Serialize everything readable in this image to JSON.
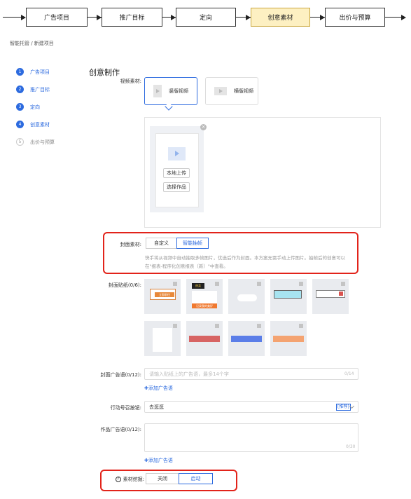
{
  "flow_steps": [
    {
      "label": "广告项目",
      "active": false
    },
    {
      "label": "推广目标",
      "active": false
    },
    {
      "label": "定向",
      "active": false
    },
    {
      "label": "创意素材",
      "active": true
    },
    {
      "label": "出价与预算",
      "active": false
    }
  ],
  "breadcrumb": "智能托管 / 新建项目",
  "side_steps": [
    {
      "num": "1",
      "label": "广告项目",
      "done": true
    },
    {
      "num": "2",
      "label": "推广目标",
      "done": true
    },
    {
      "num": "3",
      "label": "定向",
      "done": true
    },
    {
      "num": "4",
      "label": "创意素材",
      "done": true
    },
    {
      "num": "5",
      "label": "出价与预算",
      "done": false
    }
  ],
  "section_title": "创意制作",
  "video": {
    "label": "视频素材:",
    "vertical": "竖版视频",
    "horizontal": "横版视频",
    "selected": "vertical"
  },
  "upload": {
    "local_upload": "本地上传",
    "choose_work": "选择作品",
    "close": "×"
  },
  "cover": {
    "label": "封面素材:",
    "custom": "自定义",
    "smart": "智能抽帧",
    "selected": "smart",
    "tip": "快手将从视频中自动抽取多帧图片，优选后作为封面。本方案无需手动上传图片。抽帧后的创意可以在\"报表-程序化创意报表（新）\"中查看。"
  },
  "stickers": {
    "label": "封面贴纸(0/6):",
    "sample_texts": [
      "立即前往",
      "热卖",
      "记录我的美好"
    ]
  },
  "cover_ad": {
    "label": "封面广告语(0/12):",
    "placeholder": "请输入贴纸上的广告语，最多14个字",
    "count": "0/14",
    "add": "✚添加广告语"
  },
  "cta": {
    "label": "行动号召按钮:",
    "value": "去逛逛",
    "tag": "[推荐]"
  },
  "work_ad": {
    "label": "作品广告语(0/12):",
    "count": "0/30",
    "add": "✚添加广告语"
  },
  "mining": {
    "label": "素材挖掘:",
    "off": "关闭",
    "on": "启动",
    "selected": "on"
  },
  "colors": {
    "accent": "#2d6bdf",
    "highlight_frame": "#e2231a",
    "active_step": "#fdf0c2"
  }
}
